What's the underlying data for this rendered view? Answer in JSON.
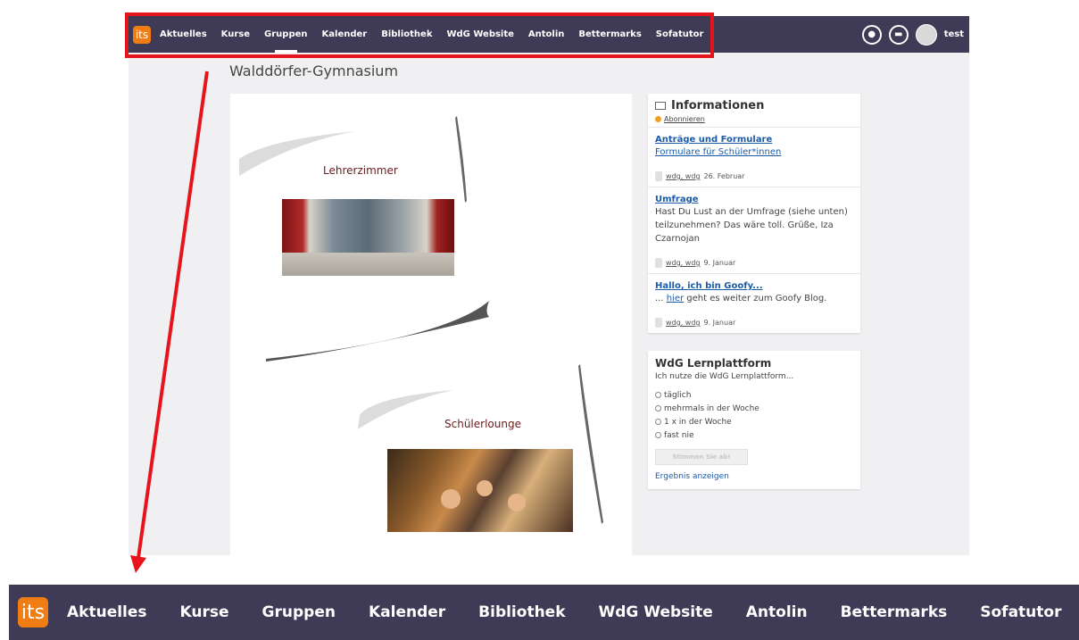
{
  "topbar": {
    "logo_text": "its",
    "nav": [
      "Aktuelles",
      "Kurse",
      "Gruppen",
      "Kalender",
      "Bibliothek",
      "WdG Website",
      "Antolin",
      "Bettermarks",
      "Sofatutor"
    ],
    "active_index": 2,
    "user": "test",
    "icons": [
      "bell-icon",
      "chat-icon"
    ]
  },
  "page": {
    "title": "Walddörfer-Gymnasium"
  },
  "board": {
    "note1_label": "Lehrerzimmer",
    "note2_label": "Schülerlounge"
  },
  "info": {
    "title": "Informationen",
    "subscribe": "Abonnieren",
    "entries": [
      {
        "title": "Anträge und Formulare",
        "link": "Formulare für Schüler*innen",
        "user": "wdg, wdg",
        "date": "26. Februar"
      },
      {
        "title": "Umfrage",
        "body": "Hast Du Lust an der Umfrage (siehe unten) teilzunehmen? Das wäre toll. Grüße, Iza Czarnojan",
        "user": "wdg, wdg",
        "date": "9. Januar"
      },
      {
        "title": "Hallo, ich bin Goofy...",
        "body_prefix": "... ",
        "body_link": "hier",
        "body_suffix": " geht es weiter zum Goofy Blog.",
        "user": "wdg, wdg",
        "date": "9. Januar"
      }
    ]
  },
  "poll": {
    "title": "WdG Lernplattform",
    "question": "Ich nutze die WdG Lernplattform...",
    "options": [
      "täglich",
      "mehrmals in der Woche",
      "1 x in der Woche",
      "fast nie"
    ],
    "vote_label": "Stimmen Sie ab!",
    "result_label": "Ergebnis anzeigen"
  },
  "colors": {
    "navbar": "#3f3a55",
    "logo": "#f07d14",
    "highlight": "#e8141c",
    "link": "#1c5ba8"
  }
}
